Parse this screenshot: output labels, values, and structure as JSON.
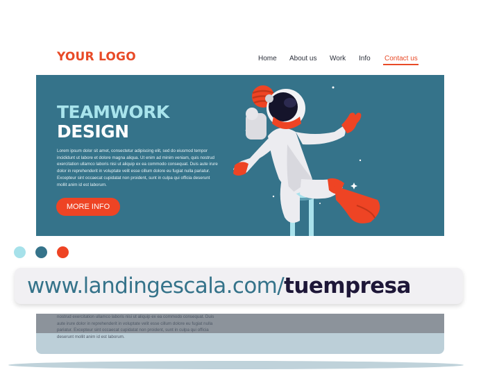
{
  "header": {
    "logo": "YOUR LOGO",
    "nav": [
      {
        "label": "Home"
      },
      {
        "label": "About us"
      },
      {
        "label": "Work"
      },
      {
        "label": "Info"
      },
      {
        "label": "Contact us",
        "active": true
      }
    ]
  },
  "hero": {
    "title_line1": "TEAMWORK",
    "title_line2": "DESIGN",
    "body": "Lorem ipsum dolor sit amet, consectetur adipiscing elit, sed do eiusmod tempor incididunt ut labore et dolore magna aliqua. Ut enim ad minim veniam, quis nostrud exercitation ullamco laboris nisi ut aliquip ex ea commodo consequat. Duis aute irure dolor in reprehenderit in voluptate velit esse cillum dolore eu fugiat nulla pariatur. Excepteur sint occaecat cupidatat non proident, sunt in culpa qui officia deserunt mollit anim id est laborum.",
    "cta": "MORE INFO",
    "illustration": "astronaut-illustration"
  },
  "window_dots": {
    "colors": [
      "#a6e1ea",
      "#35738a",
      "#ee4424"
    ]
  },
  "url_bar": {
    "base": "www.landingescala.com/",
    "path": "tuempresa"
  },
  "lower_preview": {
    "text": "nostrud exercitation ullamco laboris nisi ut aliquip ex ea commodo consequat. Duis aute irure dolor in reprehenderit in voluptate velit esse cillum dolore eu fugiat nulla pariatur. Excepteur sint occaecat cupidatat non proident, sunt in culpa qui officia deserunt mollit anim id est laborum."
  },
  "colors": {
    "accent": "#ee4424",
    "teal": "#35738a",
    "light_teal": "#a8e4ec",
    "navy": "#1e1738"
  }
}
